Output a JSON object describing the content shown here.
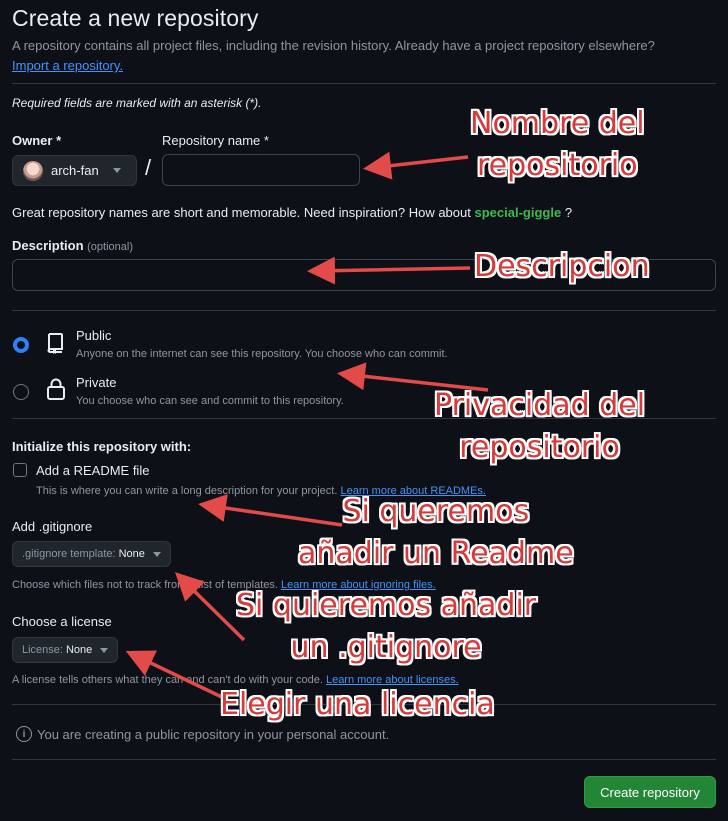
{
  "header": {
    "title": "Create a new repository",
    "subtitle": "A repository contains all project files, including the revision history. Already have a project repository elsewhere?",
    "import_link": "Import a repository."
  },
  "required_note": "Required fields are marked with an asterisk (*).",
  "owner": {
    "label": "Owner *",
    "value": "arch-fan"
  },
  "repo_name": {
    "label": "Repository name *",
    "value": ""
  },
  "slash": "/",
  "suggestion": {
    "text": "Great repository names are short and memorable. Need inspiration? How about",
    "name": "special-giggle",
    "end": "?"
  },
  "description": {
    "label": "Description",
    "optional": "(optional)",
    "value": ""
  },
  "visibility": {
    "public": {
      "title": "Public",
      "desc": "Anyone on the internet can see this repository. You choose who can commit.",
      "selected": true
    },
    "private": {
      "title": "Private",
      "desc": "You choose who can see and commit to this repository.",
      "selected": false
    }
  },
  "init": {
    "heading": "Initialize this repository with:",
    "readme_label": "Add a README file",
    "readme_desc": "This is where you can write a long description for your project.",
    "readme_link": "Learn more about READMEs."
  },
  "gitignore": {
    "heading": "Add .gitignore",
    "select_prefix": ".gitignore template:",
    "select_value": "None",
    "desc": "Choose which files not to track from a list of templates.",
    "link": "Learn more about ignoring files."
  },
  "license": {
    "heading": "Choose a license",
    "select_prefix": "License:",
    "select_value": "None",
    "desc": "A license tells others what they can and can't do with your code.",
    "link": "Learn more about licenses."
  },
  "info_note": "You are creating a public repository in your personal account.",
  "create_button": "Create repository",
  "annotations": {
    "repo_name_1": "Nombre del",
    "repo_name_2": "repositorio",
    "description": "Descripcion",
    "privacy_1": "Privacidad del",
    "privacy_2": "repositorio",
    "readme_1": "Si queremos",
    "readme_2": "añadir un Readme",
    "gitignore_1": "Si quieremos añadir",
    "gitignore_2": "un .gitignore",
    "license": "Elegir una licencia"
  },
  "colors": {
    "annotation": "#d83a3a",
    "accent": "#2f81f7",
    "button": "#238636",
    "link": "#4493f8",
    "highlight": "#3fb950"
  }
}
